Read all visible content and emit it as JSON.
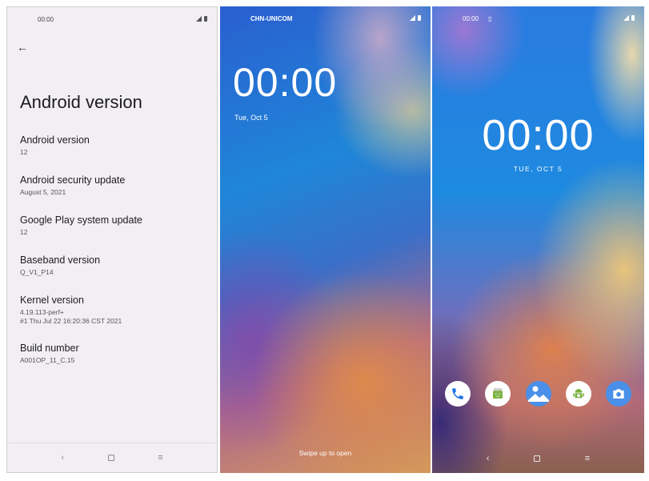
{
  "settings": {
    "status_time": "00:00",
    "page_title": "Android version",
    "items": [
      {
        "label": "Android version",
        "value": "12"
      },
      {
        "label": "Android security update",
        "value": "August 5, 2021"
      },
      {
        "label": "Google Play system update",
        "value": "12"
      },
      {
        "label": "Baseband version",
        "value": "Q_V1_P14"
      },
      {
        "label": "Kernel version",
        "value": "4.19.113-perf+\n#1 Thu Jul 22 16:20:36 CST 2021"
      },
      {
        "label": "Build number",
        "value": "A001OP_11_C.15"
      }
    ],
    "nav": {
      "back": "‹",
      "recents": "≡"
    }
  },
  "lockscreen": {
    "carrier": "CHN-UNICOM",
    "clock": "00:00",
    "date": "Tue, Oct 5",
    "hint": "Swipe up to open"
  },
  "homescreen": {
    "status_time": "00:00",
    "status_icon": "sim-icon",
    "clock": "00:00",
    "date": "TUE, OCT 5",
    "apps": [
      "phone-icon",
      "messaging-icon",
      "gallery-icon",
      "android-app-icon",
      "camera-icon"
    ],
    "accent": "#4a8fe8"
  }
}
